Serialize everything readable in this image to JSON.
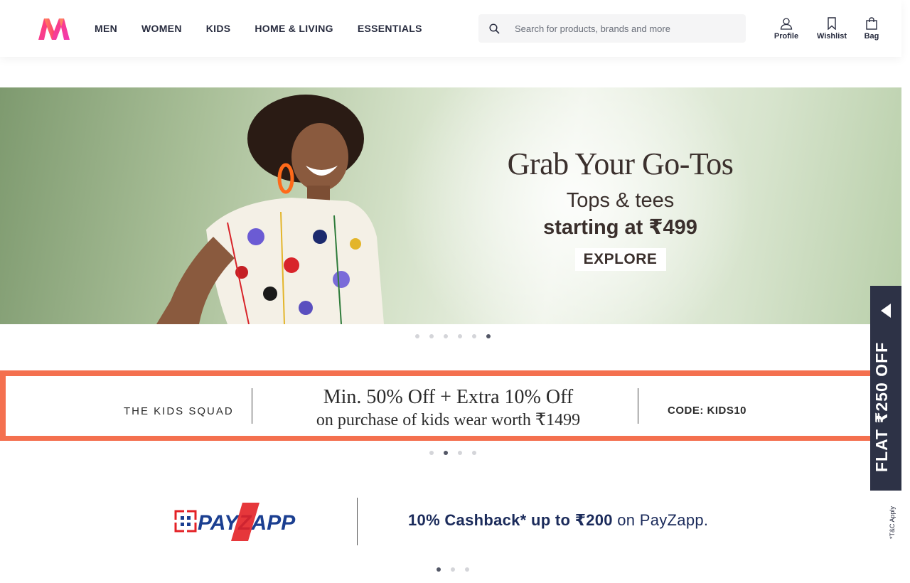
{
  "header": {
    "nav": [
      "MEN",
      "WOMEN",
      "KIDS",
      "HOME & LIVING",
      "ESSENTIALS"
    ],
    "search": {
      "placeholder": "Search for products, brands and more"
    },
    "actions": {
      "profile": "Profile",
      "wishlist": "Wishlist",
      "bag": "Bag"
    }
  },
  "hero": {
    "title": "Grab Your Go-Tos",
    "line1": "Tops & tees",
    "line2": "starting at ₹499",
    "cta": "EXPLORE",
    "dots_count": 6,
    "active_dot": 5
  },
  "kids_banner": {
    "left": "THE KIDS SQUAD",
    "line1": "Min. 50% Off + Extra 10% Off",
    "line2": "on purchase of kids wear worth ₹1499",
    "code": "CODE: KIDS10",
    "dots_count": 4,
    "active_dot": 1
  },
  "payzapp_banner": {
    "logo_text": "PAYZAPP",
    "offer_bold": "10% Cashback* up to ₹200",
    "offer_rest": " on PayZapp.",
    "dots_count": 3,
    "active_dot": 0
  },
  "side_coupon": {
    "text": "FLAT ₹250 OFF",
    "tnc": "*T&C Apply"
  },
  "colors": {
    "brand_pink": "#ff3f6c",
    "brand_orange": "#ff905a",
    "kids_border": "#f4704f",
    "coupon_bg": "#2d3246"
  },
  "icons": [
    "myntra-logo",
    "search-icon",
    "profile-icon",
    "wishlist-icon",
    "bag-icon",
    "arrow-left-icon"
  ]
}
